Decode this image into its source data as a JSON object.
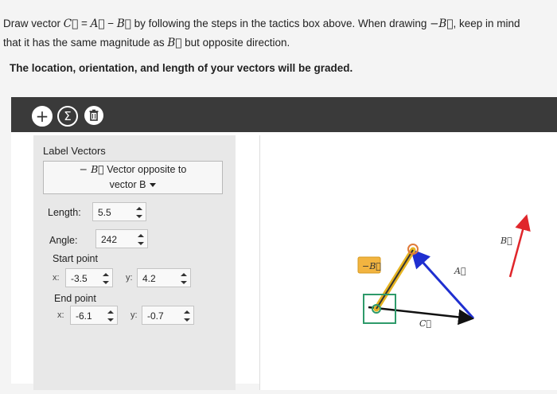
{
  "instructions": {
    "part1": "Draw vector ",
    "c_vec": "C⃗",
    "eq": " = ",
    "a_vec": "A⃗",
    "minus": " − ",
    "b_vec": "B⃗",
    "part2": " by following the steps in the tactics box above. When drawing ",
    "neg_b": "−B⃗",
    "part3": ", keep in mind",
    "line2a": "that it has the same magnitude as ",
    "line2b_vec": "B⃗",
    "line2c": " but opposite direction.",
    "bold_line": "The location, orientation, and length of your vectors will be graded."
  },
  "toolbar": {
    "add_icon": "+",
    "sum_icon": "Σ",
    "trash_icon": "🗑"
  },
  "panel": {
    "title": "Label Vectors",
    "label_vec": "− B⃗",
    "label_text_1": " Vector opposite to",
    "label_text_2": "vector B",
    "length_label": "Length:",
    "length_value": "5.5",
    "angle_label": "Angle:",
    "angle_value": "242",
    "start_label": "Start point",
    "start_x_label": "x:",
    "start_x": "-3.5",
    "start_y_label": "y:",
    "start_y": "4.2",
    "end_label": "End point",
    "end_x_label": "x:",
    "end_x": "-6.1",
    "end_y_label": "y:",
    "end_y": "-0.7"
  },
  "canvas_labels": {
    "neg_b_box": "−B⃗",
    "a_label": "A⃗",
    "b_label": "B⃗",
    "c_label": "C⃗"
  },
  "colors": {
    "toolbar": "#3a3a3a",
    "vector_a": "#1f2fd0",
    "vector_b": "#e0262b",
    "vector_c": "#111111",
    "vector_neg_b": "#e6b422",
    "start_handle": "#e07a3a",
    "end_handle": "#2e9a6a"
  }
}
